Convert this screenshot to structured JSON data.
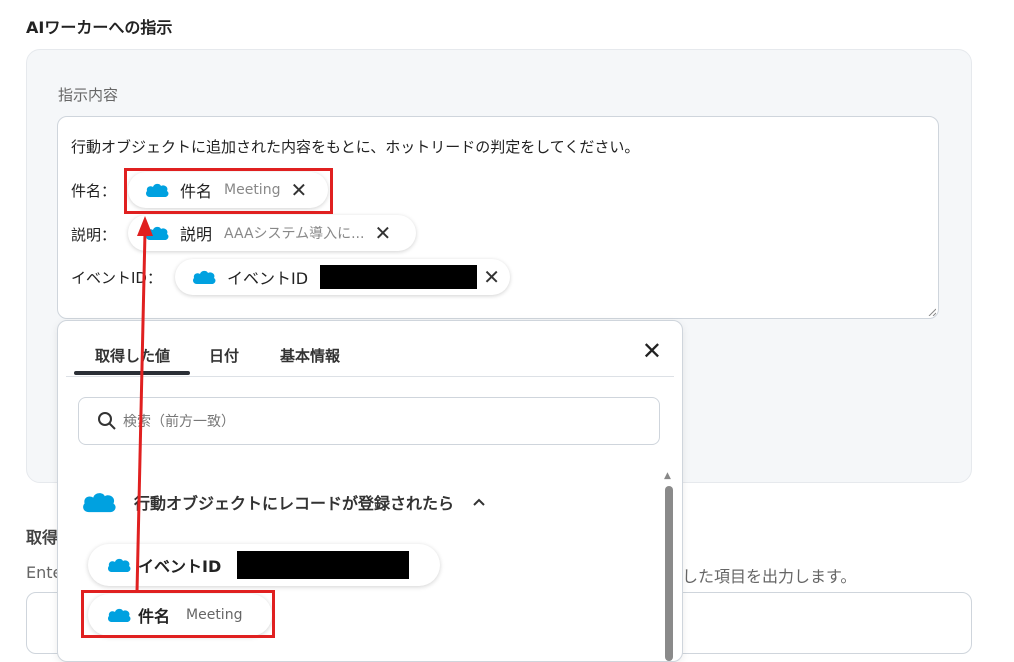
{
  "section_title": "AIワーカーへの指示",
  "instruction": {
    "label": "指示内容",
    "line1": "行動オブジェクトに追加された内容をもとに、ホットリードの判定をしてください。",
    "rows": [
      {
        "label": "件名：",
        "chip_name": "件名",
        "chip_value": "Meeting"
      },
      {
        "label": "説明：",
        "chip_name": "説明",
        "chip_value": "AAAシステム導入に..."
      },
      {
        "label": "イベントID：",
        "chip_name": "イベントID",
        "chip_value": ""
      }
    ],
    "remove_glyph": "✕"
  },
  "dropdown": {
    "tabs": [
      "取得した値",
      "日付",
      "基本情報"
    ],
    "active_tab": 0,
    "close_glyph": "✕",
    "search_placeholder": "検索（前方一致）",
    "group_name": "行動オブジェクトにレコードが登録されたら",
    "group_chevron": "^",
    "options": [
      {
        "name": "イベントID",
        "value": ""
      },
      {
        "name": "件名",
        "value": "Meeting"
      }
    ]
  },
  "background": {
    "partial_heading": "取得",
    "partial_left": "Ente",
    "partial_right": "した項目を出力します。"
  },
  "colors": {
    "salesforce_blue": "#00a1e0",
    "highlight_red": "#e02020"
  },
  "icons": {
    "chip_icon": "salesforce-cloud-icon",
    "search_icon": "search-icon",
    "close_icon": "close-icon",
    "chevron_icon": "chevron-up-icon"
  }
}
